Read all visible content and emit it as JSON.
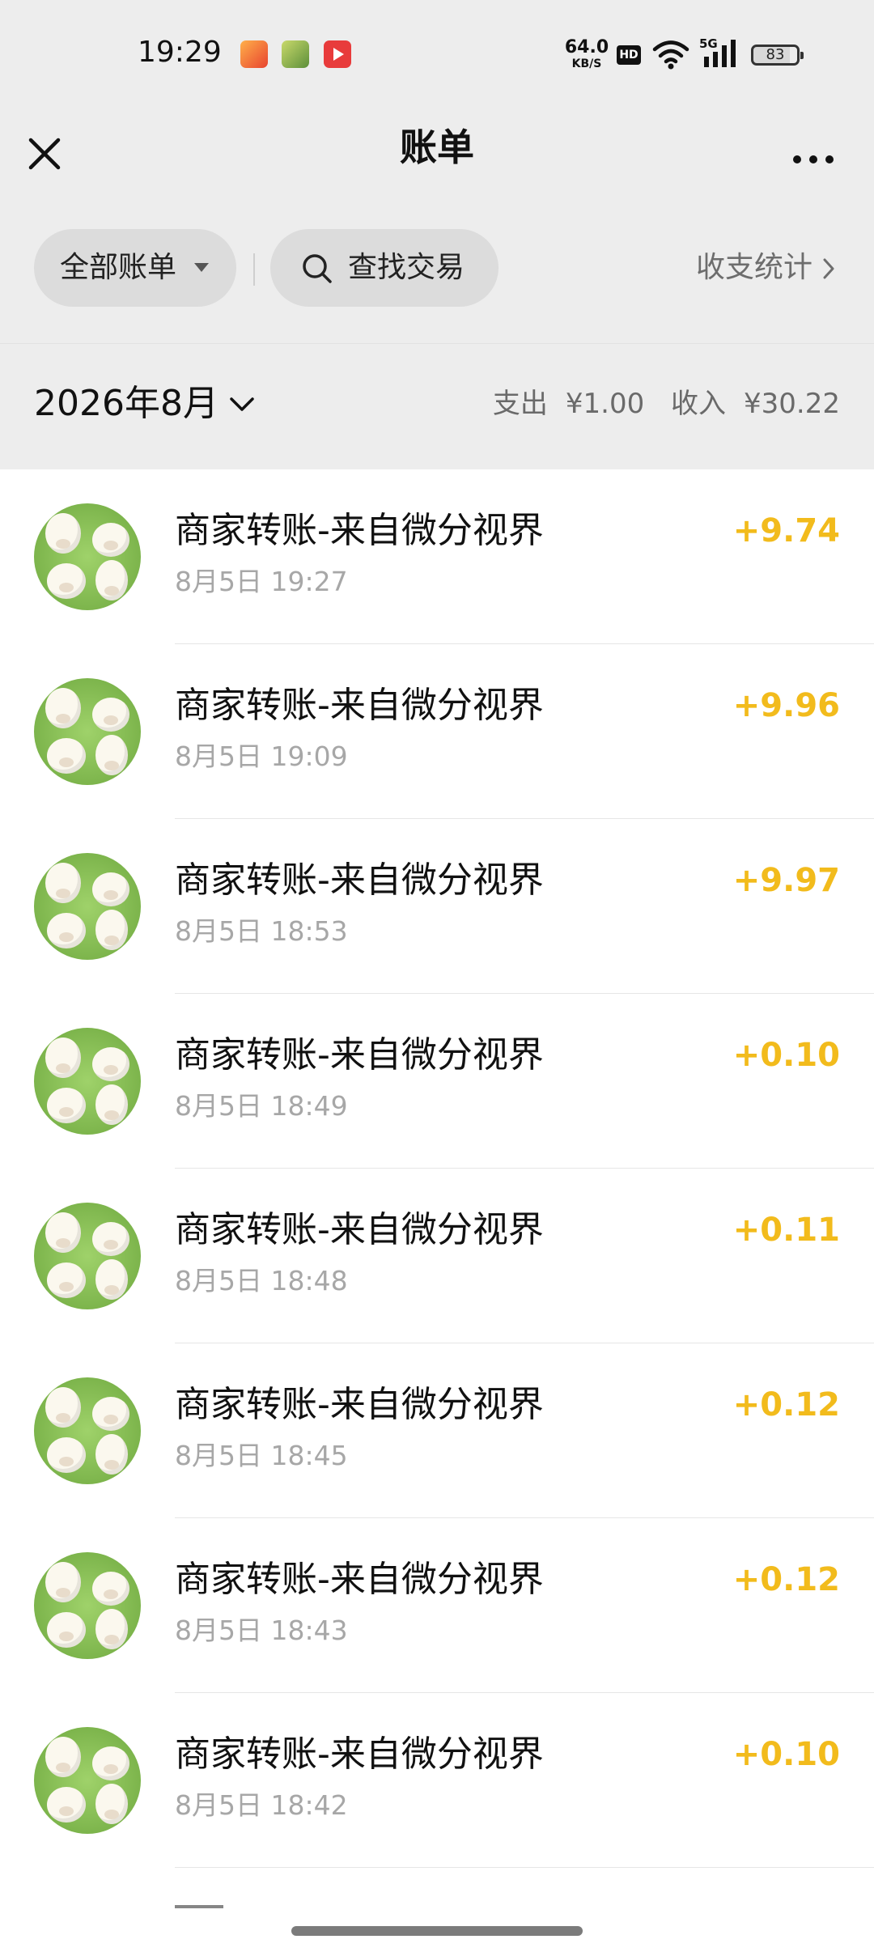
{
  "status_bar": {
    "time": "19:29",
    "net_speed_value": "64.0",
    "net_speed_unit": "KB/S",
    "hd_label": "HD",
    "network_label": "5G",
    "battery": "83",
    "app_icons": [
      "notification-app-icon-orange",
      "notification-app-icon-green",
      "video-app-icon-red"
    ]
  },
  "nav": {
    "title": "账单",
    "close_icon": "close-icon",
    "more_icon": "more-dots-icon"
  },
  "filters": {
    "all_bills_label": "全部账单",
    "search_label": "查找交易",
    "stats_label": "收支统计"
  },
  "month": {
    "label": "2026年8月",
    "expense_label": "支出",
    "expense_value": "¥1.00",
    "income_label": "收入",
    "income_value": "¥30.22"
  },
  "colors": {
    "income_amount": "#f2bb1c",
    "header_background": "#ededed"
  },
  "bills": [
    {
      "name": "商家转账-来自微分视界",
      "time": "8月5日 19:27",
      "amount": "+9.74"
    },
    {
      "name": "商家转账-来自微分视界",
      "time": "8月5日 19:09",
      "amount": "+9.96"
    },
    {
      "name": "商家转账-来自微分视界",
      "time": "8月5日 18:53",
      "amount": "+9.97"
    },
    {
      "name": "商家转账-来自微分视界",
      "time": "8月5日 18:49",
      "amount": "+0.10"
    },
    {
      "name": "商家转账-来自微分视界",
      "time": "8月5日 18:48",
      "amount": "+0.11"
    },
    {
      "name": "商家转账-来自微分视界",
      "time": "8月5日 18:45",
      "amount": "+0.12"
    },
    {
      "name": "商家转账-来自微分视界",
      "time": "8月5日 18:43",
      "amount": "+0.12"
    },
    {
      "name": "商家转账-来自微分视界",
      "time": "8月5日 18:42",
      "amount": "+0.10"
    }
  ]
}
